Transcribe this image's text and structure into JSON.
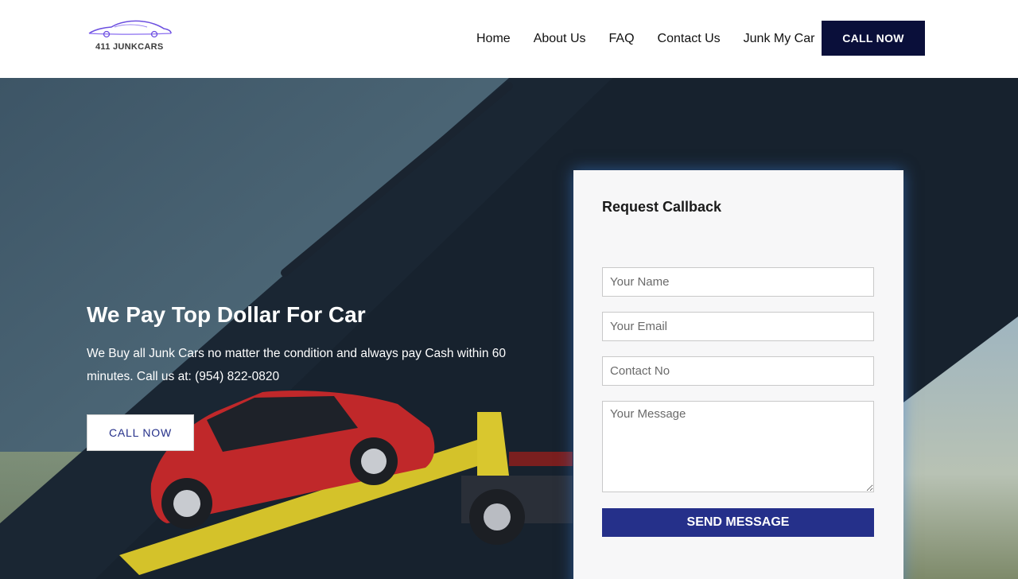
{
  "header": {
    "logo_text": "411 JUNKCARS",
    "nav": [
      "Home",
      "About Us",
      "FAQ",
      "Contact Us",
      "Junk My Car"
    ],
    "call_label": "CALL NOW"
  },
  "hero": {
    "title": "We Pay Top Dollar For Car",
    "description": "We Buy all Junk Cars no matter the condition and always pay Cash within 60 minutes. Call us at: (954) 822-0820",
    "call_label": "CALL NOW"
  },
  "form": {
    "title": "Request Callback",
    "name_placeholder": "Your Name",
    "email_placeholder": "Your Email",
    "contact_placeholder": "Contact No",
    "message_placeholder": "Your Message",
    "submit_label": "SEND MESSAGE"
  },
  "colors": {
    "brand_dark": "#0a0f3a",
    "accent_blue": "#25308a",
    "hero_bg": "#1b2733"
  }
}
